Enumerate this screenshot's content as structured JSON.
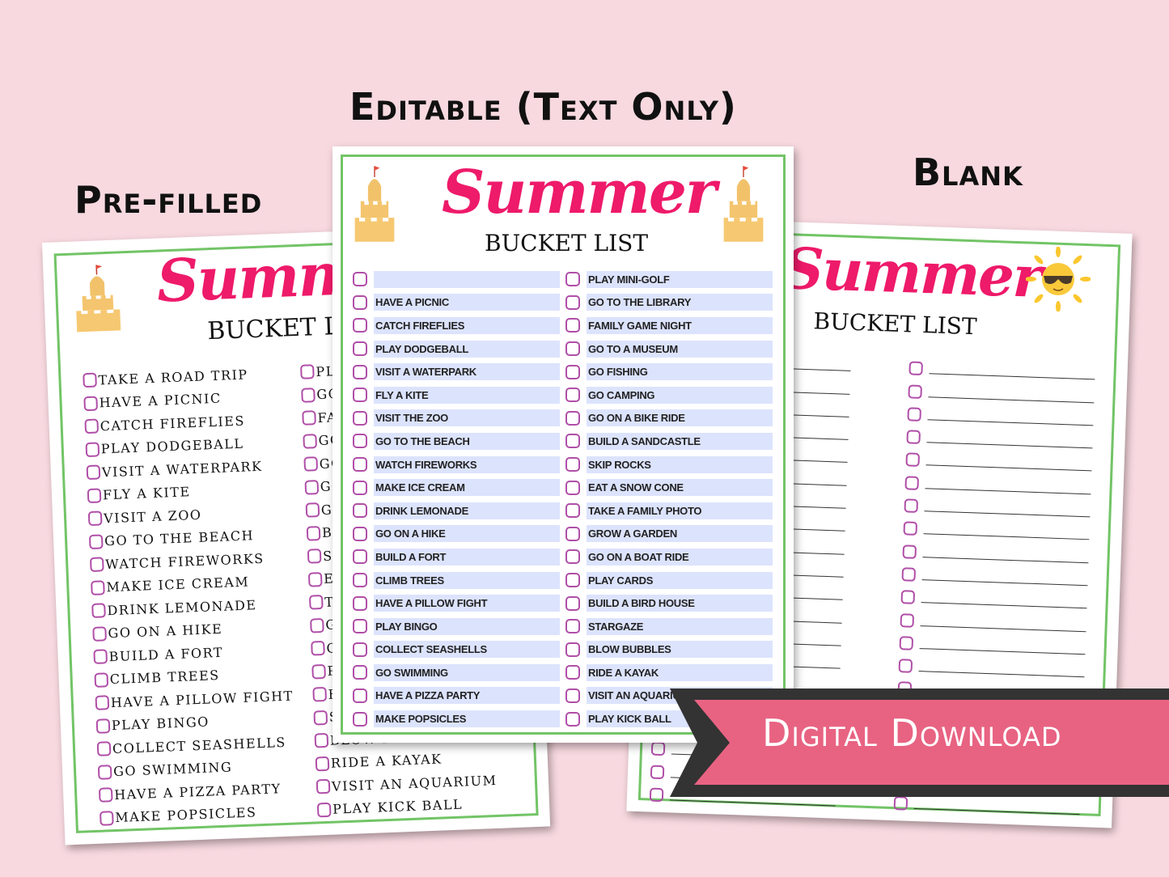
{
  "labels": {
    "prefilled": "Pre-filled",
    "editable": "Editable (Text Only)",
    "blank": "Blank"
  },
  "sheet": {
    "title": "Summer",
    "subtitle": "BUCKET LIST"
  },
  "prefilled": {
    "left_column": [
      "TAKE A ROAD TRIP",
      "HAVE A PICNIC",
      "CATCH FIREFLIES",
      "PLAY DODGEBALL",
      "VISIT A WATERPARK",
      "FLY A KITE",
      "VISIT A ZOO",
      "GO TO THE BEACH",
      "WATCH FIREWORKS",
      "MAKE ICE CREAM",
      "DRINK LEMONADE",
      "GO ON A HIKE",
      "BUILD A FORT",
      "CLIMB TREES",
      "HAVE A PILLOW FIGHT",
      "PLAY BINGO",
      "COLLECT SEASHELLS",
      "GO SWIMMING",
      "HAVE A PIZZA PARTY",
      "MAKE POPSICLES"
    ],
    "right_column": [
      "PLAY MINI-GOLF",
      "GO TO THE LIBRARY",
      "FAMILY GAME NIGHT",
      "GO TO A MUSEUM",
      "GO FISHING",
      "GO CAMPING",
      "GO ON A BIKE RIDE",
      "BUILD A SANDCASTLE",
      "SKIP ROCKS",
      "EAT A SNOW CONE",
      "TAKE A FAMILY PHOTO",
      "GROW A GARDEN",
      "GO ON A BOAT RIDE",
      "PLAY CARDS",
      "BUILD A BIRD HOUSE",
      "STARGAZE",
      "BLOW BUBBLES",
      "RIDE A KAYAK",
      "VISIT AN AQUARIUM",
      "PLAY KICK BALL"
    ]
  },
  "editable": {
    "left_column": [
      "",
      "HAVE A PICNIC",
      "CATCH FIREFLIES",
      "PLAY DODGEBALL",
      "VISIT A WATERPARK",
      "FLY A KITE",
      "VISIT THE ZOO",
      "GO TO THE BEACH",
      "WATCH FIREWORKS",
      "MAKE ICE CREAM",
      "DRINK LEMONADE",
      "GO ON A HIKE",
      "BUILD A FORT",
      "CLIMB TREES",
      "HAVE A PILLOW FIGHT",
      "PLAY BINGO",
      "COLLECT SEASHELLS",
      "GO SWIMMING",
      "HAVE A PIZZA PARTY",
      "MAKE POPSICLES"
    ],
    "right_column": [
      "PLAY MINI-GOLF",
      "GO TO THE LIBRARY",
      "FAMILY GAME NIGHT",
      "GO TO A MUSEUM",
      "GO FISHING",
      "GO CAMPING",
      "GO ON A BIKE RIDE",
      "BUILD A SANDCASTLE",
      "SKIP ROCKS",
      "EAT A SNOW CONE",
      "TAKE A FAMILY PHOTO",
      "GROW A GARDEN",
      "GO ON A BOAT RIDE",
      "PLAY CARDS",
      "BUILD A BIRD HOUSE",
      "STARGAZE",
      "BLOW BUBBLES",
      "RIDE A KAYAK",
      "VISIT AN AQUARIUM",
      "PLAY KICK BALL"
    ]
  },
  "blank": {
    "rows_per_column": 20
  },
  "banner": {
    "text": "Digital Download"
  },
  "colors": {
    "background": "#f8d9e0",
    "title_pink": "#ee1a6a",
    "frame_green": "#72c466",
    "checkbox_purple": "#b04ea8",
    "field_blue": "#dce3fd",
    "banner_pink": "#e86382",
    "banner_dark": "#333333"
  },
  "icons": {
    "castle": "sandcastle-icon",
    "sun": "sun-with-sunglasses-icon"
  }
}
